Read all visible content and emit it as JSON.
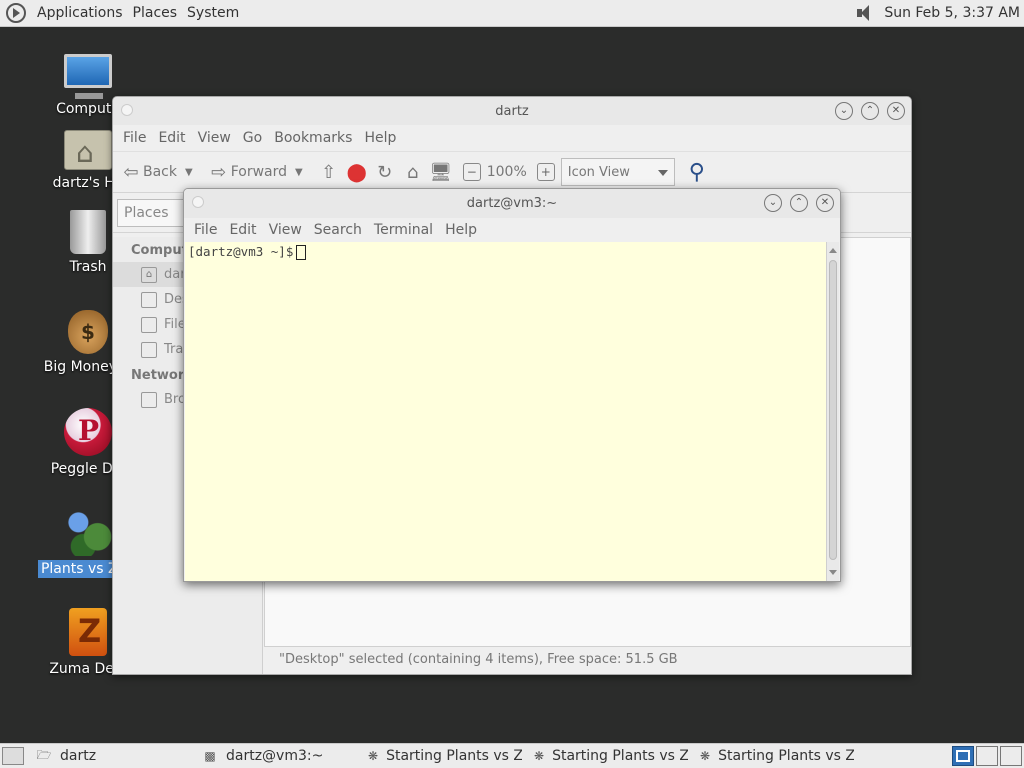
{
  "top_panel": {
    "menus": [
      "Applications",
      "Places",
      "System"
    ],
    "clock": "Sun Feb  5,  3:37 AM"
  },
  "desktop_icons": [
    {
      "label": "Compute",
      "icon": "computer-icon"
    },
    {
      "label": "dartz's Ho",
      "icon": "home-folder-icon"
    },
    {
      "label": "Trash",
      "icon": "trash-icon"
    },
    {
      "label": "Big Money D",
      "icon": "big-money-icon"
    },
    {
      "label": "Peggle Del",
      "icon": "peggle-icon"
    },
    {
      "label": "Plants vs Zon",
      "icon": "plants-vs-zombies-icon",
      "selected": true
    },
    {
      "label": "Zuma Delu",
      "icon": "zuma-icon"
    }
  ],
  "nautilus": {
    "title": "dartz",
    "menu": [
      "File",
      "Edit",
      "View",
      "Go",
      "Bookmarks",
      "Help"
    ],
    "toolbar": {
      "back": "Back",
      "forward": "Forward",
      "zoom": "100%",
      "view_mode": "Icon View"
    },
    "places_combo": "Places",
    "sidebar": {
      "computer_head": "Comput",
      "computer_items": [
        "dar",
        "Des",
        "File",
        "Tra"
      ],
      "network_head": "Network",
      "network_items": [
        "Bro"
      ]
    },
    "status": "\"Desktop\" selected (containing 4 items), Free space: 51.5 GB"
  },
  "terminal": {
    "title": "dartz@vm3:~",
    "menu": [
      "File",
      "Edit",
      "View",
      "Search",
      "Terminal",
      "Help"
    ],
    "prompt": "[dartz@vm3 ~]$"
  },
  "bottom_panel": {
    "tasks": [
      {
        "label": "dartz",
        "icon": "folder-icon"
      },
      {
        "label": "dartz@vm3:~",
        "icon": "terminal-icon"
      },
      {
        "label": "Starting Plants vs Z...",
        "icon": "launch-icon"
      },
      {
        "label": "Starting Plants vs Z...",
        "icon": "launch-icon"
      },
      {
        "label": "Starting Plants vs Z...",
        "icon": "launch-icon"
      }
    ]
  }
}
